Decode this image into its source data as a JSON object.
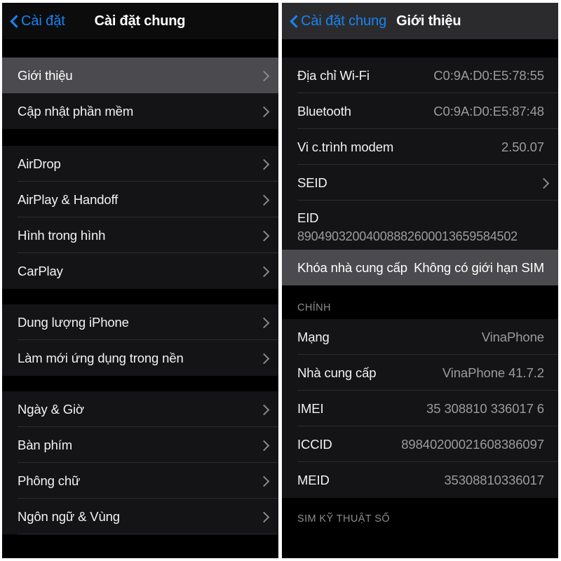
{
  "left_panel": {
    "navbar": {
      "back_label": "Cài đặt",
      "title": "Cài đặt chung",
      "back_icon": "chevron-left-icon"
    },
    "groups": [
      {
        "rows": [
          {
            "label": "Giới thiệu",
            "accessory": "chevron-right-icon",
            "selected": true
          },
          {
            "label": "Cập nhật phần mềm",
            "accessory": "chevron-right-icon",
            "selected": false
          }
        ]
      },
      {
        "rows": [
          {
            "label": "AirDrop",
            "accessory": "chevron-right-icon",
            "selected": false
          },
          {
            "label": "AirPlay & Handoff",
            "accessory": "chevron-right-icon",
            "selected": false
          },
          {
            "label": "Hình trong hình",
            "accessory": "chevron-right-icon",
            "selected": false
          },
          {
            "label": "CarPlay",
            "accessory": "chevron-right-icon",
            "selected": false
          }
        ]
      },
      {
        "rows": [
          {
            "label": "Dung lượng iPhone",
            "accessory": "chevron-right-icon",
            "selected": false
          },
          {
            "label": "Làm mới ứng dụng trong nền",
            "accessory": "chevron-right-icon",
            "selected": false
          }
        ]
      },
      {
        "rows": [
          {
            "label": "Ngày & Giờ",
            "accessory": "chevron-right-icon",
            "selected": false
          },
          {
            "label": "Bàn phím",
            "accessory": "chevron-right-icon",
            "selected": false
          },
          {
            "label": "Phông chữ",
            "accessory": "chevron-right-icon",
            "selected": false
          },
          {
            "label": "Ngôn ngữ & Vùng",
            "accessory": "chevron-right-icon",
            "selected": false
          }
        ]
      }
    ]
  },
  "right_panel": {
    "navbar": {
      "back_label": "Cài đặt chung",
      "title": "Giới thiệu",
      "back_icon": "chevron-left-icon"
    },
    "rows_top": [
      {
        "label": "Địa chỉ Wi-Fi",
        "value": "C0:9A:D0:E5:78:55"
      },
      {
        "label": "Bluetooth",
        "value": "C0:9A:D0:E5:87:48"
      },
      {
        "label": "Vi c.trình modem",
        "value": "2.50.07"
      },
      {
        "label": "SEID",
        "value": "",
        "accessory": "chevron-right-icon"
      }
    ],
    "eid_row": {
      "label": "EID",
      "value": "89049032004008882600013659584502"
    },
    "carrier_lock_row": {
      "label": "Khóa nhà cung cấp",
      "value": "Không có giới hạn SIM",
      "selected": true
    },
    "section_main": {
      "header": "CHÍNH",
      "rows": [
        {
          "label": "Mạng",
          "value": "VinaPhone"
        },
        {
          "label": "Nhà cung cấp",
          "value": "VinaPhone 41.7.2"
        },
        {
          "label": "IMEI",
          "value": "35 308810 336017 6"
        },
        {
          "label": "ICCID",
          "value": "89840200021608386097"
        },
        {
          "label": "MEID",
          "value": "35308810336017"
        }
      ]
    },
    "section_esim": {
      "header": "SIM KỸ THUẬT SỐ"
    }
  },
  "colors": {
    "accent_blue": "#1784f5",
    "selected_row": "#4b4b4f",
    "value_gray": "#9b9b9f",
    "separator": "#2c2c2e",
    "page_background": "#000000"
  }
}
